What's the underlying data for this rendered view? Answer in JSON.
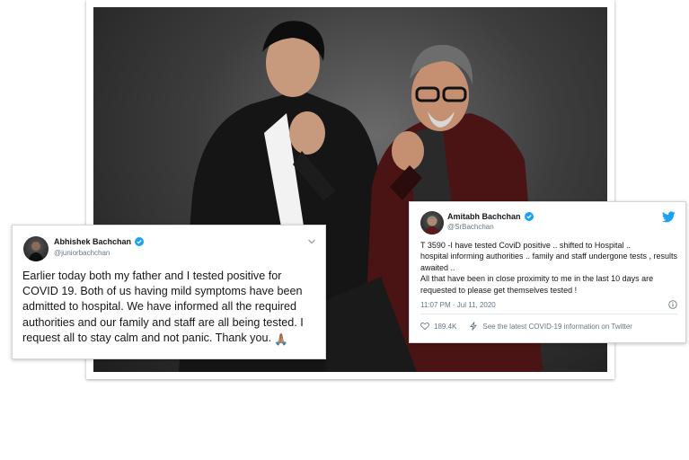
{
  "photo": {
    "description_icon": "portrait-photo"
  },
  "tweet_abhishek": {
    "name": "Abhishek Bachchan",
    "handle": "@juniorbachchan",
    "text": "Earlier today both my father and I tested positive for COVID 19. Both of us having mild symptoms have been admitted to hospital. We have informed all the required authorities and our family and staff are all being tested. I request all to stay calm and not panic. Thank you.",
    "emoji": "🙏🏽"
  },
  "tweet_amitabh": {
    "name": "Amitabh Bachchan",
    "handle": "@SrBachchan",
    "text": "T 3590 -I have tested CoviD positive ..  shifted to Hospital  ..\nhospital informing  authorities .. family and staff undergone tests , results awaited ..\nAll that have been in close proximity to me in the last 10 days are requested to please get themselves tested !",
    "timestamp": "11:07 PM · Jul 11, 2020",
    "likes": "189.4K",
    "info_link": "See the latest COVID-19 information on Twitter"
  },
  "colors": {
    "twitter_blue": "#1da1f2",
    "text": "#14171a",
    "secondary": "#657786"
  }
}
